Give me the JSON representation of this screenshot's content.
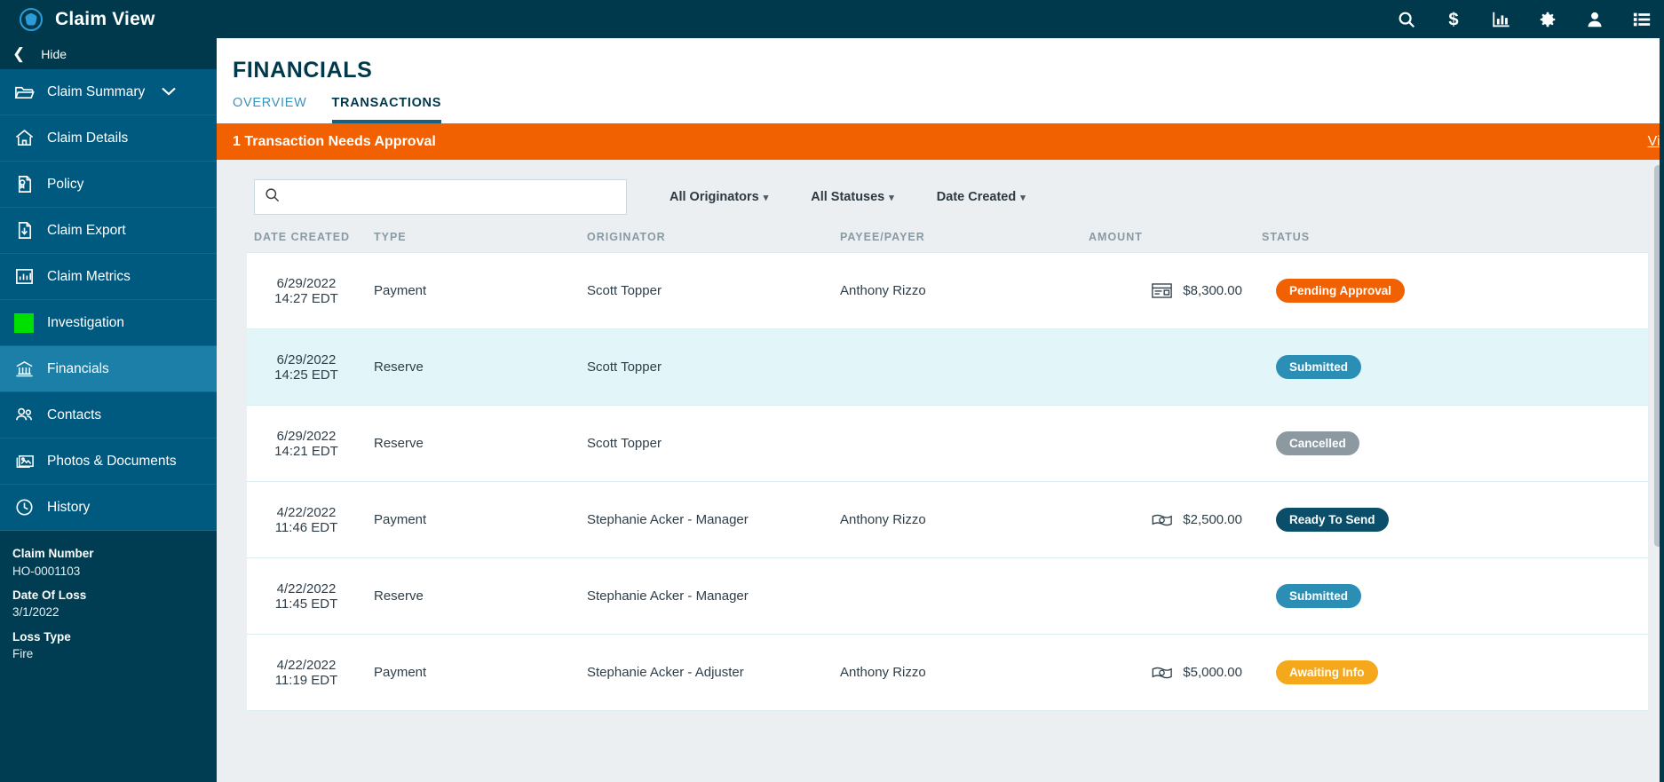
{
  "app": {
    "title": "Claim View",
    "logo_icon": "aperture-icon"
  },
  "topbar": {
    "icons": [
      {
        "name": "search-icon",
        "label": "Search"
      },
      {
        "name": "dollar-icon",
        "label": "Financials"
      },
      {
        "name": "bar-chart-icon",
        "label": "Reports"
      },
      {
        "name": "gear-icon",
        "label": "Settings"
      },
      {
        "name": "person-icon",
        "label": "Account"
      },
      {
        "name": "list-menu-icon",
        "label": "Menu"
      }
    ]
  },
  "sidebar": {
    "hide_label": "Hide",
    "hide_icon": "chevron-left-icon",
    "items": [
      {
        "label": "Claim Summary",
        "icon": "folder-icon",
        "active": false,
        "expandable": true
      },
      {
        "label": "Claim Details",
        "icon": "home-icon",
        "active": false,
        "expandable": false
      },
      {
        "label": "Policy",
        "icon": "policy-doc-icon",
        "active": false,
        "expandable": false
      },
      {
        "label": "Claim Export",
        "icon": "export-doc-icon",
        "active": false,
        "expandable": false
      },
      {
        "label": "Claim Metrics",
        "icon": "chart-icon",
        "active": false,
        "expandable": false
      },
      {
        "label": "Investigation",
        "icon": "green-square-icon",
        "active": false,
        "expandable": false
      },
      {
        "label": "Financials",
        "icon": "bank-icon",
        "active": true,
        "expandable": false
      },
      {
        "label": "Contacts",
        "icon": "people-icon",
        "active": false,
        "expandable": false
      },
      {
        "label": "Photos & Documents",
        "icon": "photos-icon",
        "active": false,
        "expandable": false
      },
      {
        "label": "History",
        "icon": "clock-icon",
        "active": false,
        "expandable": false
      }
    ],
    "claim_info": [
      {
        "label": "Claim Number",
        "value": "HO-0001103"
      },
      {
        "label": "Date Of Loss",
        "value": "3/1/2022"
      },
      {
        "label": "Loss Type",
        "value": "Fire"
      }
    ]
  },
  "main": {
    "page_title": "FINANCIALS",
    "tabs": [
      {
        "label": "OVERVIEW",
        "active": false
      },
      {
        "label": "TRANSACTIONS",
        "active": true
      }
    ],
    "alert": {
      "text": "1 Transaction Needs Approval",
      "link_label": "View",
      "color": "#F26101"
    },
    "search": {
      "value": "",
      "placeholder": "",
      "icon": "search-icon"
    },
    "filters": [
      {
        "label": "All Originators",
        "caret": "chevron-down-icon"
      },
      {
        "label": "All Statuses",
        "caret": "chevron-down-icon"
      },
      {
        "label": "Date Created",
        "caret": "chevron-down-icon"
      }
    ],
    "table": {
      "columns": [
        "DATE CREATED",
        "TYPE",
        "ORIGINATOR",
        "PAYEE/PAYER",
        "AMOUNT",
        "STATUS"
      ],
      "rows": [
        {
          "date": "6/29/2022",
          "time": "14:27 EDT",
          "type": "Payment",
          "originator": "Scott Topper",
          "payee": "Anthony Rizzo",
          "amount": "$8,300.00",
          "amount_icon": "check-icon",
          "status": "Pending Approval",
          "status_color": "#F26101",
          "highlight": false
        },
        {
          "date": "6/29/2022",
          "time": "14:25 EDT",
          "type": "Reserve",
          "originator": "Scott Topper",
          "payee": "",
          "amount": "",
          "amount_icon": "",
          "status": "Submitted",
          "status_color": "#2B8FB5",
          "highlight": true
        },
        {
          "date": "6/29/2022",
          "time": "14:21 EDT",
          "type": "Reserve",
          "originator": "Scott Topper",
          "payee": "",
          "amount": "",
          "amount_icon": "",
          "status": "Cancelled",
          "status_color": "#8C99A1",
          "highlight": false
        },
        {
          "date": "4/22/2022",
          "time": "11:46 EDT",
          "type": "Payment",
          "originator": "Stephanie Acker - Manager",
          "payee": "Anthony Rizzo",
          "amount": "$2,500.00",
          "amount_icon": "cash-icon",
          "status": "Ready To Send",
          "status_color": "#0A4E69",
          "highlight": false
        },
        {
          "date": "4/22/2022",
          "time": "11:45 EDT",
          "type": "Reserve",
          "originator": "Stephanie Acker - Manager",
          "payee": "",
          "amount": "",
          "amount_icon": "",
          "status": "Submitted",
          "status_color": "#2B8FB5",
          "highlight": false
        },
        {
          "date": "4/22/2022",
          "time": "11:19 EDT",
          "type": "Payment",
          "originator": "Stephanie Acker - Adjuster",
          "payee": "Anthony Rizzo",
          "amount": "$5,000.00",
          "amount_icon": "cash-icon",
          "status": "Awaiting Info",
          "status_color": "#F5A81C",
          "highlight": false
        }
      ]
    }
  },
  "colors": {
    "header_bg": "#00394B",
    "sidebar_bg": "#005A7F",
    "sidebar_active": "#1B7FA8",
    "accent_orange": "#F26101",
    "content_bg": "#EBEFF1",
    "row_highlight": "#E2F5F9"
  }
}
